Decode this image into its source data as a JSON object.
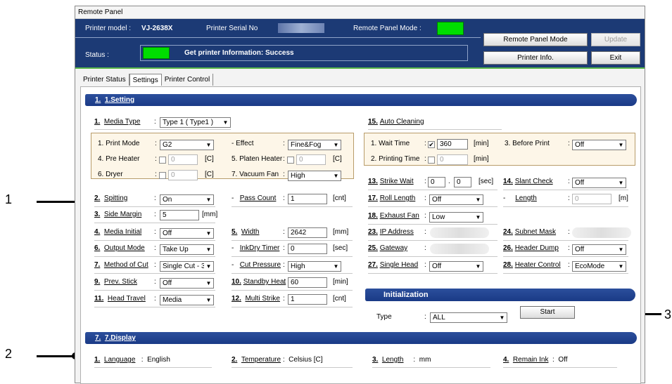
{
  "callouts": [
    "1",
    "2",
    "3"
  ],
  "window": {
    "title": "Remote Panel",
    "printer_model_label": "Printer model :",
    "printer_model": "VJ-2638X",
    "serial_label": "Printer Serial No",
    "mode_label": "Remote Panel Mode :",
    "status_label": "Status :",
    "status_message": "Get printer Information: Success",
    "buttons": {
      "remote_panel_mode": "Remote Panel Mode",
      "update": "Update",
      "printer_info": "Printer Info.",
      "exit": "Exit"
    }
  },
  "tabs": [
    "Printer Status",
    "Settings",
    "Printer Control"
  ],
  "setting": {
    "header_num": "1.",
    "header": "1.Setting",
    "media_type": {
      "num": "1.",
      "label": "Media Type",
      "value": "Type 1 ( Type1 )"
    },
    "print_mode": {
      "label": "1. Print Mode",
      "value": "G2"
    },
    "effect": {
      "label": "- Effect",
      "value": "Fine&Fog"
    },
    "pre_heater": {
      "label": "4. Pre Heater",
      "value": "0",
      "unit": "[C]"
    },
    "platen_heater": {
      "label": "5. Platen Heater",
      "value": "0",
      "unit": "[C]"
    },
    "dryer": {
      "label": "6. Dryer",
      "value": "0",
      "unit": "[C]"
    },
    "vacuum_fan": {
      "label": "7. Vacuum Fan",
      "value": "High"
    },
    "spitting": {
      "num": "2.",
      "label": "Spitting",
      "value": "On"
    },
    "pass_count": {
      "num": "-",
      "label": "Pass Count",
      "value": "1",
      "unit": "[cnt]"
    },
    "side_margin": {
      "num": "3.",
      "label": "Side Margin",
      "value": "5",
      "unit": "[mm]"
    },
    "media_initial": {
      "num": "4.",
      "label": "Media Initial",
      "value": "Off"
    },
    "width": {
      "num": "5.",
      "label": "Width",
      "value": "2642",
      "unit": "[mm]"
    },
    "output_mode": {
      "num": "6.",
      "label": "Output Mode",
      "value": "Take Up"
    },
    "inkdry_timer": {
      "num": "-",
      "label": "InkDry Timer",
      "value": "0",
      "unit": "[sec]"
    },
    "method_of_cut": {
      "num": "7.",
      "label": "Method of Cut",
      "value": "Single Cut - 3"
    },
    "cut_pressure": {
      "num": "-",
      "label": "Cut Pressure",
      "value": "High"
    },
    "prev_stick": {
      "num": "9.",
      "label": "Prev. Stick",
      "value": "Off"
    },
    "standby_heat": {
      "num": "10.",
      "label": "Standby Heat",
      "value": "60",
      "unit": "[min]"
    },
    "head_travel": {
      "num": "11.",
      "label": "Head Travel",
      "value": "Media"
    },
    "multi_strike": {
      "num": "12.",
      "label": "Multi Strike",
      "value": "1",
      "unit": "[cnt]"
    },
    "auto_cleaning": {
      "num": "15.",
      "label": "Auto Cleaning"
    },
    "wait_time": {
      "label": "1. Wait Time",
      "checked": "✔",
      "value": "360",
      "unit": "[min]"
    },
    "before_print": {
      "label": "3. Before Print",
      "value": "Off"
    },
    "printing_time": {
      "label": "2. Printing Time",
      "value": "0",
      "unit": "[min]"
    },
    "strike_wait": {
      "num": "13.",
      "label": "Strike Wait",
      "value1": "0",
      "sep": ".",
      "value2": "0",
      "unit": "[sec]"
    },
    "slant_check": {
      "num": "14.",
      "label": "Slant Check",
      "value": "Off"
    },
    "roll_length": {
      "num": "17.",
      "label": "Roll Length",
      "value": "Off"
    },
    "length": {
      "num": "-",
      "label": "Length",
      "value": "0",
      "unit": "[m]"
    },
    "exhaust_fan": {
      "num": "18.",
      "label": "Exhaust Fan",
      "value": "Low"
    },
    "ip_address": {
      "num": "23.",
      "label": "IP Address"
    },
    "subnet_mask": {
      "num": "24.",
      "label": "Subnet Mask"
    },
    "gateway": {
      "num": "25.",
      "label": "Gateway"
    },
    "header_dump": {
      "num": "26.",
      "label": "Header Dump",
      "value": "Off"
    },
    "single_head": {
      "num": "27.",
      "label": "Single Head",
      "value": "Off"
    },
    "heater_control": {
      "num": "28.",
      "label": "Heater Control",
      "value": "EcoMode"
    }
  },
  "initialization": {
    "title": "Initialization",
    "type_label": "Type",
    "type_value": "ALL",
    "start": "Start"
  },
  "display": {
    "header_num": "7.",
    "header": "7.Display",
    "language": {
      "num": "1.",
      "label": "Language",
      "value": "English"
    },
    "temperature": {
      "num": "2.",
      "label": "Temperature",
      "value": "Celsius [C]"
    },
    "length": {
      "num": "3.",
      "label": "Length",
      "value": "mm"
    },
    "remain_ink": {
      "num": "4.",
      "label": "Remain Ink",
      "value": "Off"
    }
  }
}
